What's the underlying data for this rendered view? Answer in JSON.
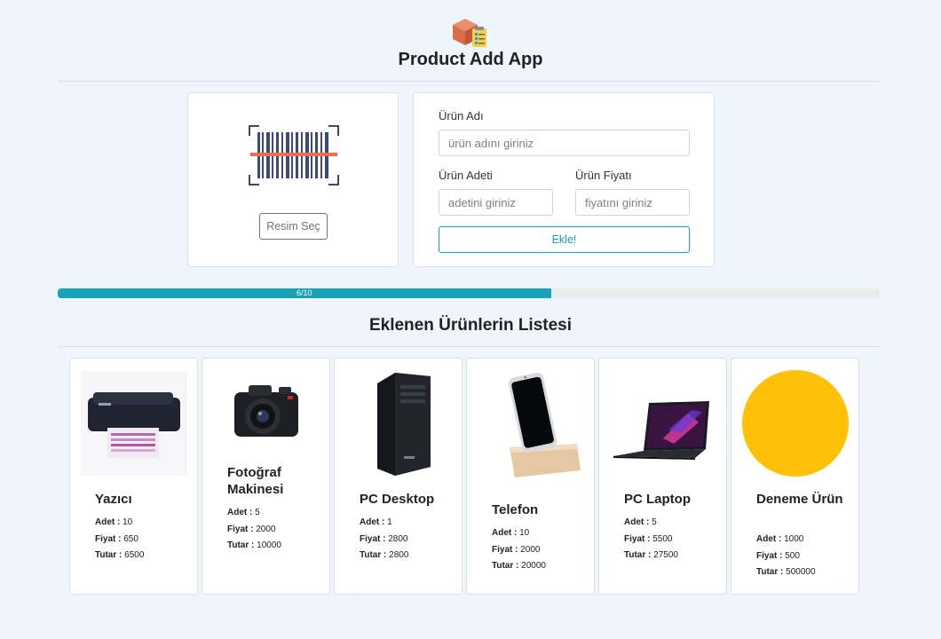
{
  "header": {
    "title": "Product Add App",
    "logo_icon": "package-checklist-icon"
  },
  "image_picker": {
    "barcode_icon": "barcode-scan-icon",
    "button_label": "Resim Seç"
  },
  "form": {
    "name_label": "Ürün Adı",
    "name_placeholder": "ürün adını giriniz",
    "qty_label": "Ürün Adeti",
    "qty_placeholder": "adetini giriniz",
    "price_label": "Ürün Fiyatı",
    "price_placeholder": "fiyatını giriniz",
    "submit_label": "Ekle!"
  },
  "progress": {
    "label": "6/10",
    "value": 0.6,
    "color": "#17a2b8"
  },
  "list": {
    "title": "Eklenen Ürünlerin Listesi",
    "qty_key": "Adet :",
    "price_key": "Fiyat :",
    "total_key": "Tutar :"
  },
  "products": [
    {
      "name": "Yazıcı",
      "qty": "10",
      "price": "650",
      "total": "6500",
      "icon": "printer-icon"
    },
    {
      "name": "Fotoğraf Makinesi",
      "qty": "5",
      "price": "2000",
      "total": "10000",
      "icon": "camera-icon"
    },
    {
      "name": "PC Desktop",
      "qty": "1",
      "price": "2800",
      "total": "2800",
      "icon": "desktop-tower-icon"
    },
    {
      "name": "Telefon",
      "qty": "10",
      "price": "2000",
      "total": "20000",
      "icon": "phone-icon"
    },
    {
      "name": "PC Laptop",
      "qty": "5",
      "price": "5500",
      "total": "27500",
      "icon": "laptop-icon"
    },
    {
      "name": "Deneme Ürün",
      "qty": "1000",
      "price": "500",
      "total": "500000",
      "icon": "yellow-circle-icon"
    }
  ]
}
